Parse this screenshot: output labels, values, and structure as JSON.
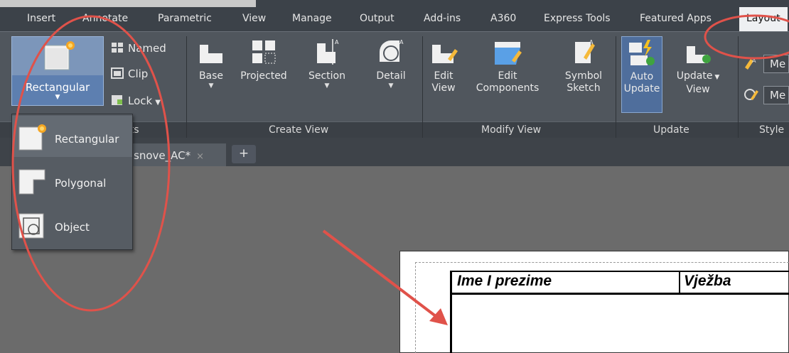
{
  "ribbon_tabs": [
    "Insert",
    "Annotate",
    "Parametric",
    "View",
    "Manage",
    "Output",
    "Add-ins",
    "A360",
    "Express Tools",
    "Featured Apps",
    "Layout"
  ],
  "active_tab": "Layout",
  "create_view": {
    "base": "Base",
    "projected": "Projected",
    "section": "Section",
    "detail": "Detail",
    "panel_title": "Create View"
  },
  "viewport": {
    "rectangular": "Rectangular",
    "named": "Named",
    "clip": "Clip",
    "lock": "Lock",
    "panel_title_partial": "rts"
  },
  "modify_view": {
    "edit_view_line1": "Edit",
    "edit_view_line2": "View",
    "edit_components_line1": "Edit",
    "edit_components_line2": "Components",
    "symbol_sketch_line1": "Symbol",
    "symbol_sketch_line2": "Sketch",
    "panel_title": "Modify View"
  },
  "update": {
    "auto_update_line1": "Auto",
    "auto_update_line2": "Update",
    "update_view_line1": "Update",
    "update_view_line2": "View",
    "panel_title": "Update"
  },
  "styles": {
    "btn1": "Me",
    "btn2": "Me",
    "panel_title_partial": "Style"
  },
  "document_tab": {
    "label": "snove_AC*",
    "close": "×",
    "new_tab": "+"
  },
  "dropdown": {
    "items": [
      {
        "label": "Rectangular"
      },
      {
        "label": "Polygonal"
      },
      {
        "label": "Object"
      }
    ]
  },
  "title_block": {
    "col1": "Ime I prezime",
    "col2": "Vježba"
  },
  "colors": {
    "annotation": "#e0524a",
    "ribbon": "#50565d",
    "highlight": "#5d7fb0"
  }
}
